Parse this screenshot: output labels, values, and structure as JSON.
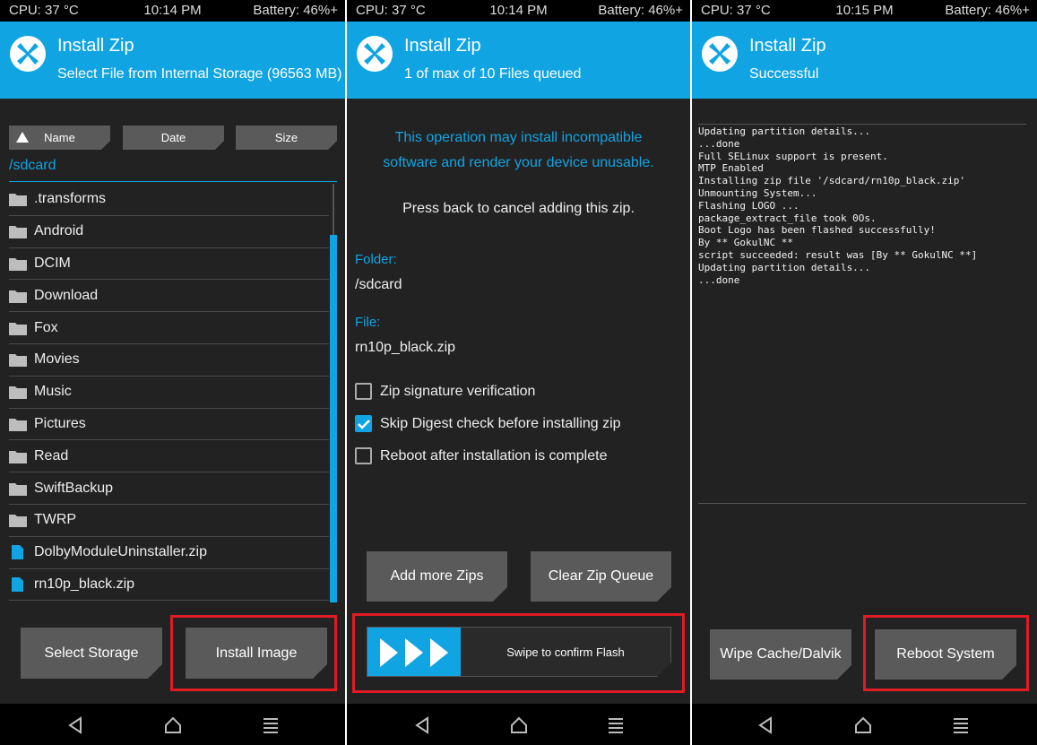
{
  "status": {
    "cpu": "CPU: 37 °C",
    "battery": "Battery: 46%+",
    "time1": "10:14 PM",
    "time2": "10:14 PM",
    "time3": "10:15 PM"
  },
  "panel1": {
    "title": "Install Zip",
    "subtitle": "Select File from Internal Storage (96563 MB)",
    "sort": {
      "name": "Name",
      "date": "Date",
      "size": "Size"
    },
    "path": "/sdcard",
    "files": [
      {
        "name": ".transforms",
        "type": "folder"
      },
      {
        "name": "Android",
        "type": "folder"
      },
      {
        "name": "DCIM",
        "type": "folder"
      },
      {
        "name": "Download",
        "type": "folder"
      },
      {
        "name": "Fox",
        "type": "folder"
      },
      {
        "name": "Movies",
        "type": "folder"
      },
      {
        "name": "Music",
        "type": "folder"
      },
      {
        "name": "Pictures",
        "type": "folder"
      },
      {
        "name": "Read",
        "type": "folder"
      },
      {
        "name": "SwiftBackup",
        "type": "folder"
      },
      {
        "name": "TWRP",
        "type": "folder"
      },
      {
        "name": "DolbyModuleUninstaller.zip",
        "type": "file"
      },
      {
        "name": "rn10p_black.zip",
        "type": "file"
      }
    ],
    "select_storage": "Select Storage",
    "install_image": "Install Image"
  },
  "panel2": {
    "title": "Install Zip",
    "subtitle": "1 of max of 10 Files queued",
    "warning_line1": "This operation may install incompatible",
    "warning_line2": "software and render your device unusable.",
    "note": "Press back to cancel adding this zip.",
    "folder_label": "Folder:",
    "folder_value": "/sdcard",
    "file_label": "File:",
    "file_value": "rn10p_black.zip",
    "checkboxes": [
      {
        "label": "Zip signature verification",
        "checked": false
      },
      {
        "label": "Skip Digest check before installing zip",
        "checked": true
      },
      {
        "label": "Reboot after installation is complete",
        "checked": false
      }
    ],
    "add_more": "Add more Zips",
    "clear_queue": "Clear Zip Queue",
    "swipe": "Swipe to confirm Flash"
  },
  "panel3": {
    "title": "Install Zip",
    "subtitle": "Successful",
    "log": [
      "Updating partition details...",
      "...done",
      "Full SELinux support is present.",
      "MTP Enabled",
      "Installing zip file '/sdcard/rn10p_black.zip'",
      "Unmounting System...",
      "Flashing LOGO ...",
      "package_extract_file took 0Os.",
      "Boot Logo has been flashed successfully!",
      "By ** GokulNC **",
      "script succeeded: result was [By ** GokulNC **]",
      "Updating partition details...",
      "...done"
    ],
    "wipe": "Wipe Cache/Dalvik",
    "reboot": "Reboot System"
  },
  "colors": {
    "accent": "#11a4e3",
    "highlight": "#e01b24",
    "background": "#222222",
    "button": "#5a5a5a"
  }
}
